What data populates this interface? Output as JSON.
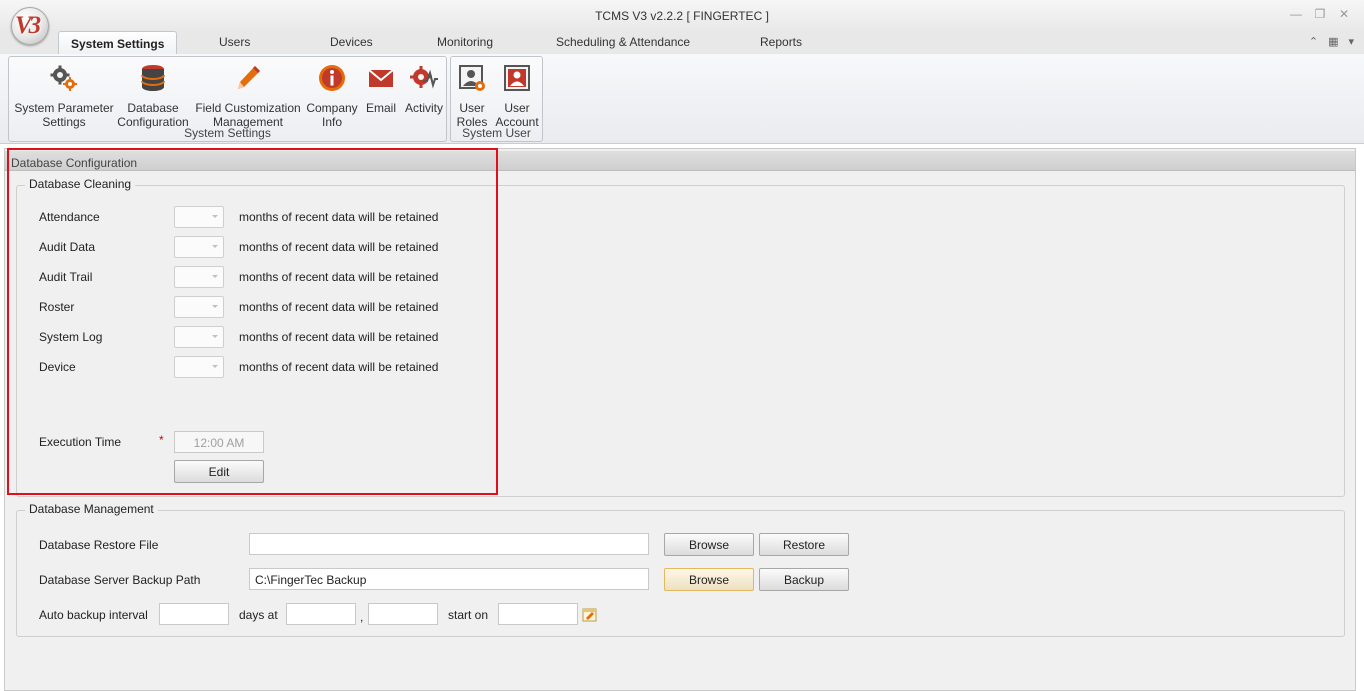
{
  "window": {
    "title": "TCMS V3 v2.2.2 [ FINGERTEC ]",
    "logo_text": "V3",
    "controls": [
      "minimize-icon",
      "restore-icon",
      "close-icon"
    ]
  },
  "tabs": [
    {
      "label": "System Settings",
      "active": true
    },
    {
      "label": "Users"
    },
    {
      "label": "Devices"
    },
    {
      "label": "Monitoring"
    },
    {
      "label": "Scheduling & Attendance"
    },
    {
      "label": "Reports"
    }
  ],
  "ribbon": {
    "system_settings": {
      "label": "System Settings",
      "buttons": [
        {
          "line1": "System Parameter",
          "line2": "Settings",
          "icon": "gears-icon"
        },
        {
          "line1": "Database",
          "line2": "Configuration",
          "icon": "database-icon"
        },
        {
          "line1": "Field Customization",
          "line2": "Management",
          "icon": "pencil-icon"
        },
        {
          "line1": "Company",
          "line2": "Info",
          "icon": "info-icon"
        },
        {
          "line1": "Email",
          "line2": "",
          "icon": "envelope-icon"
        },
        {
          "line1": "Activity",
          "line2": "",
          "icon": "activity-gear-icon"
        }
      ]
    },
    "system_user": {
      "label": "System User",
      "buttons": [
        {
          "line1": "User",
          "line2": "Roles",
          "icon": "user-roles-icon"
        },
        {
          "line1": "User",
          "line2": "Account",
          "icon": "user-account-icon"
        }
      ]
    }
  },
  "panel": {
    "title": "Database Configuration",
    "cleaning": {
      "title": "Database Cleaning",
      "suffix": "months of recent data will be retained",
      "rows": [
        {
          "label": "Attendance",
          "value": ""
        },
        {
          "label": "Audit Data",
          "value": ""
        },
        {
          "label": "Audit Trail",
          "value": ""
        },
        {
          "label": "Roster",
          "value": ""
        },
        {
          "label": "System Log",
          "value": ""
        },
        {
          "label": "Device",
          "value": ""
        }
      ],
      "execution_label": "Execution Time",
      "required_mark": "*",
      "execution_time": "12:00 AM",
      "edit_label": "Edit"
    },
    "management": {
      "title": "Database Management",
      "restore_label": "Database Restore File",
      "restore_value": "",
      "backup_path_label": "Database Server Backup Path",
      "backup_path_value": "C:\\FingerTec Backup",
      "browse_label": "Browse",
      "restore_button": "Restore",
      "backup_button": "Backup",
      "auto_backup_label": "Auto backup interval",
      "days_at_label": "days at",
      "comma": ",",
      "start_on_label": "start on",
      "interval_value": "",
      "hour_value": "",
      "minute_value": "",
      "start_value": ""
    }
  },
  "colors": {
    "highlight_border": "#e0101a",
    "required": "#d40000",
    "logo_text": "#c0392b"
  }
}
